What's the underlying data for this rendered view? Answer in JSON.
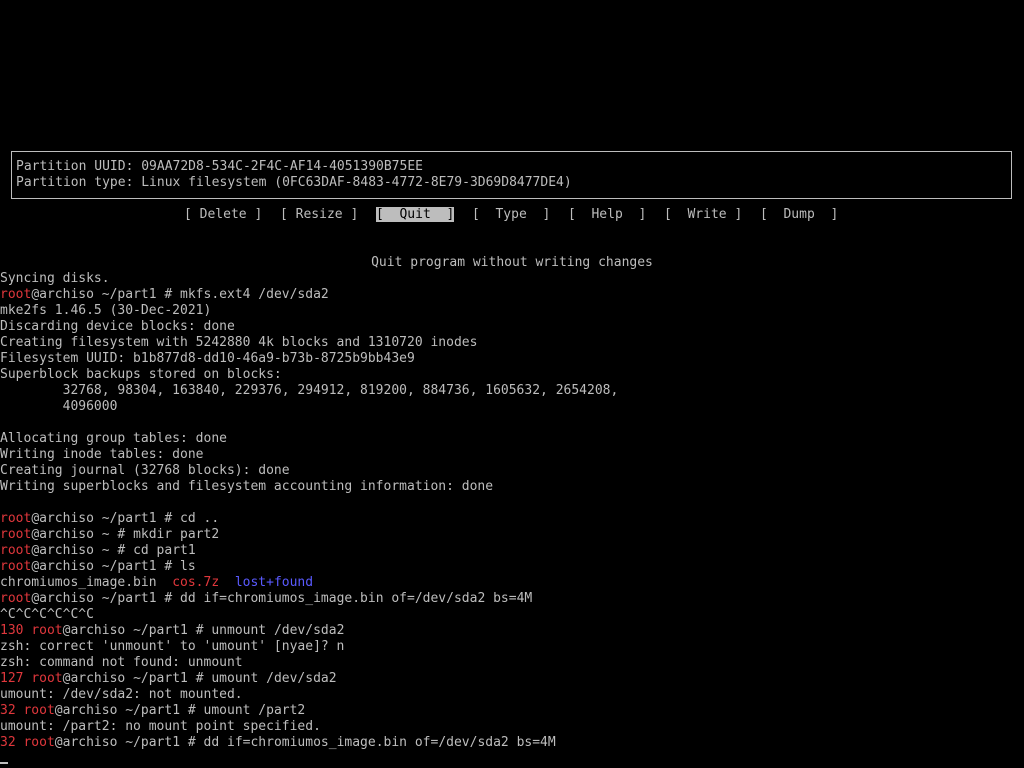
{
  "partition_info": {
    "uuid_line": "Partition UUID: 09AA72D8-534C-2F4C-AF14-4051390B75EE",
    "type_line": "Partition type: Linux filesystem (0FC63DAF-8483-4772-8E79-3D69D8477DE4)"
  },
  "menu": [
    {
      "prefix": "[ ",
      "label": "Delete",
      "suffix": " ]"
    },
    {
      "prefix": "[ ",
      "label": "Resize",
      "suffix": " ]"
    },
    {
      "prefix": "",
      "label": "[  Quit  ]",
      "suffix": "",
      "selected": true
    },
    {
      "prefix": "[ ",
      "label": " Type ",
      "suffix": " ]"
    },
    {
      "prefix": "[ ",
      "label": " Help ",
      "suffix": " ]"
    },
    {
      "prefix": "[ ",
      "label": " Write",
      "suffix": " ]"
    },
    {
      "prefix": "[ ",
      "label": " Dump ",
      "suffix": " ]"
    }
  ],
  "status": "Quit program without writing changes",
  "prompt": {
    "user": "root",
    "host": "@archiso"
  },
  "terminal": {
    "l01": "Syncing disks.",
    "l02_path": " ~/part1 # mkfs.ext4 /dev/sda2",
    "l03": "mke2fs 1.46.5 (30-Dec-2021)",
    "l04": "Discarding device blocks: done",
    "l05": "Creating filesystem with 5242880 4k blocks and 1310720 inodes",
    "l06": "Filesystem UUID: b1b877d8-dd10-46a9-b73b-8725b9bb43e9",
    "l07": "Superblock backups stored on blocks:",
    "l08": "        32768, 98304, 163840, 229376, 294912, 819200, 884736, 1605632, 2654208,",
    "l09": "        4096000",
    "l10": "",
    "l11": "Allocating group tables: done",
    "l12": "Writing inode tables: done",
    "l13": "Creating journal (32768 blocks): done",
    "l14": "Writing superblocks and filesystem accounting information: done",
    "l15": "",
    "l16_path": " ~/part1 # cd ..",
    "l17_path": " ~ # mkdir part2",
    "l18_path": " ~ # cd part1",
    "l19_path": " ~/part1 # ls",
    "l20_file1": "chromiumos_image.bin  ",
    "l20_file2": "cos.7z",
    "l20_sep": "  ",
    "l20_file3": "lost+found",
    "l21_path": " ~/part1 # dd if=chromiumos_image.bin of=/dev/sda2 bs=4M",
    "l22": "^C^C^C^C^C^C",
    "l23_code": "130 ",
    "l23_path": " ~/part1 # unmount /dev/sda2",
    "l24": "zsh: correct 'unmount' to 'umount' [nyae]? n",
    "l25": "zsh: command not found: unmount",
    "l26_code": "127 ",
    "l26_path": " ~/part1 # umount /dev/sda2",
    "l27": "umount: /dev/sda2: not mounted.",
    "l28_code": "32 ",
    "l28_path": " ~/part1 # umount /part2",
    "l29": "umount: /part2: no mount point specified.",
    "l30_code": "32 ",
    "l30_path": " ~/part1 # dd if=chromiumos_image.bin of=/dev/sda2 bs=4M"
  },
  "colors": {
    "background": "#000000",
    "text": "#bdbdbd",
    "prompt_user": "#e0373c",
    "directory": "#5a5aff",
    "archive": "#e0373c"
  }
}
